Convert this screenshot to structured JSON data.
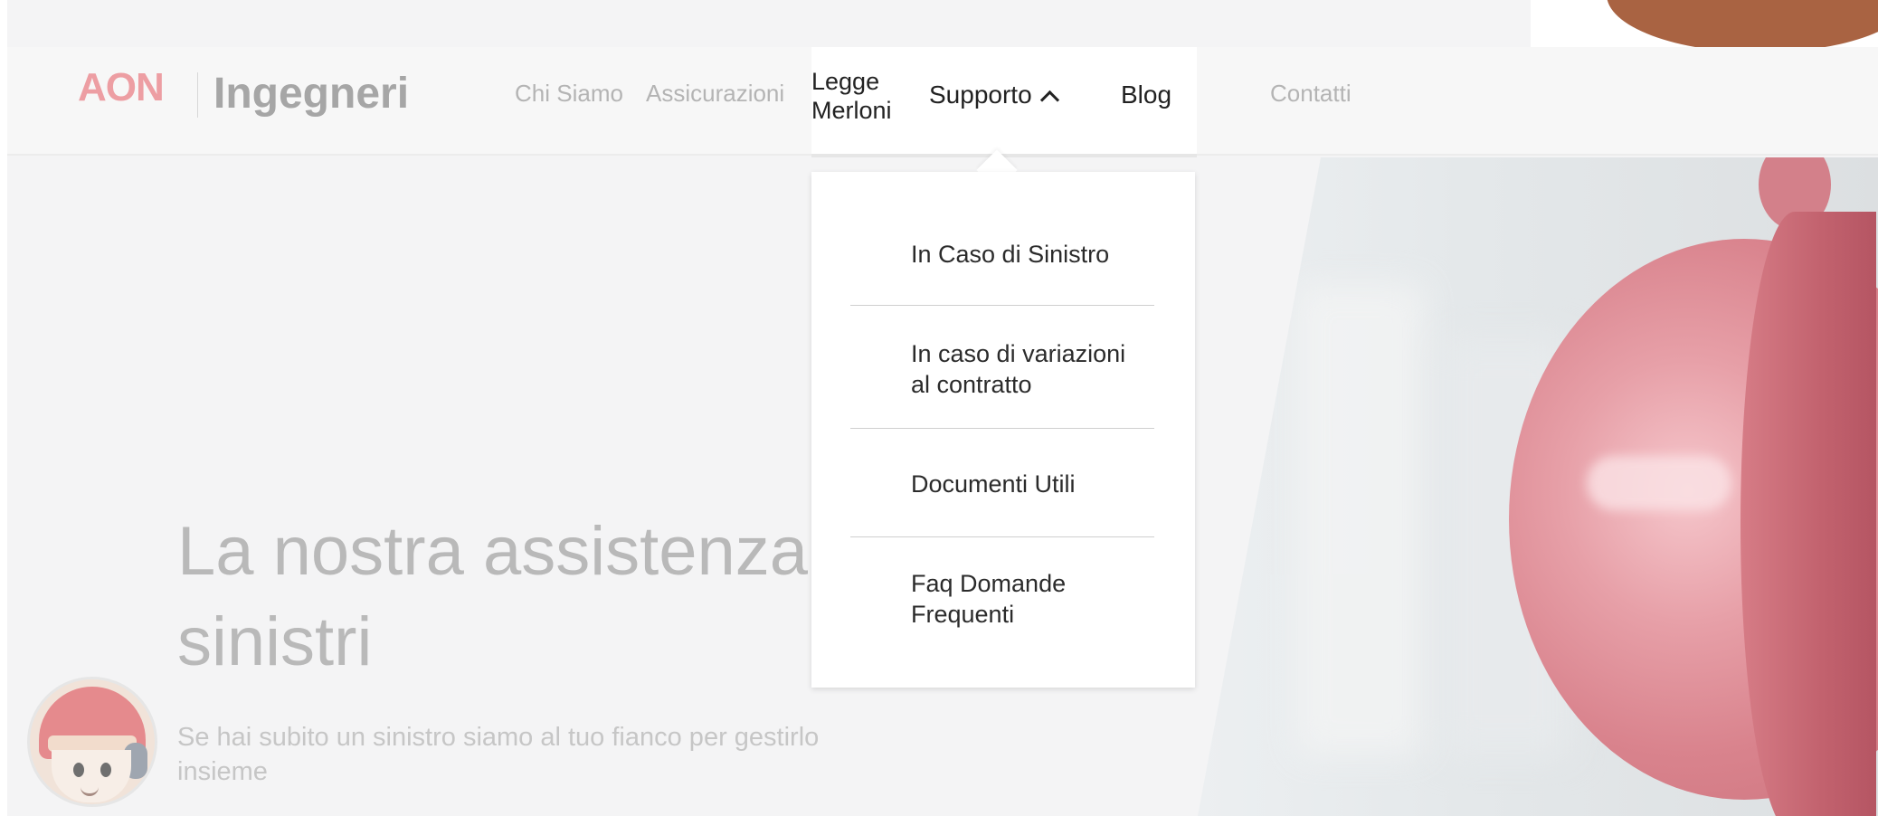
{
  "brand": {
    "logo": "AON",
    "subtitle": "Ingegneri"
  },
  "nav": {
    "chi_siamo": "Chi Siamo",
    "assicurazioni": "Assicurazioni",
    "legge_line1": "Legge",
    "legge_line2": "Merloni",
    "supporto": "Supporto",
    "blog": "Blog",
    "contatti": "Contatti"
  },
  "dropdown": {
    "items": [
      {
        "line1": "In Caso di Sinistro",
        "line2": ""
      },
      {
        "line1": "In caso di variazioni",
        "line2": "al contratto"
      },
      {
        "line1": "Documenti Utili",
        "line2": ""
      },
      {
        "line1": "Faq Domande",
        "line2": "Frequenti"
      }
    ]
  },
  "hero": {
    "title_line1": "La nostra assistenza",
    "title_line2": "sinistri",
    "subtitle_line1": "Se hai subito un sinistro siamo al tuo fianco per gestirlo",
    "subtitle_line2": "insieme"
  },
  "colors": {
    "brand_red": "#e8001d",
    "text_dark": "#222222"
  },
  "icons": {
    "supporto_chevron": "chevron-up-icon",
    "mascot": "chatbot-avatar-icon"
  }
}
